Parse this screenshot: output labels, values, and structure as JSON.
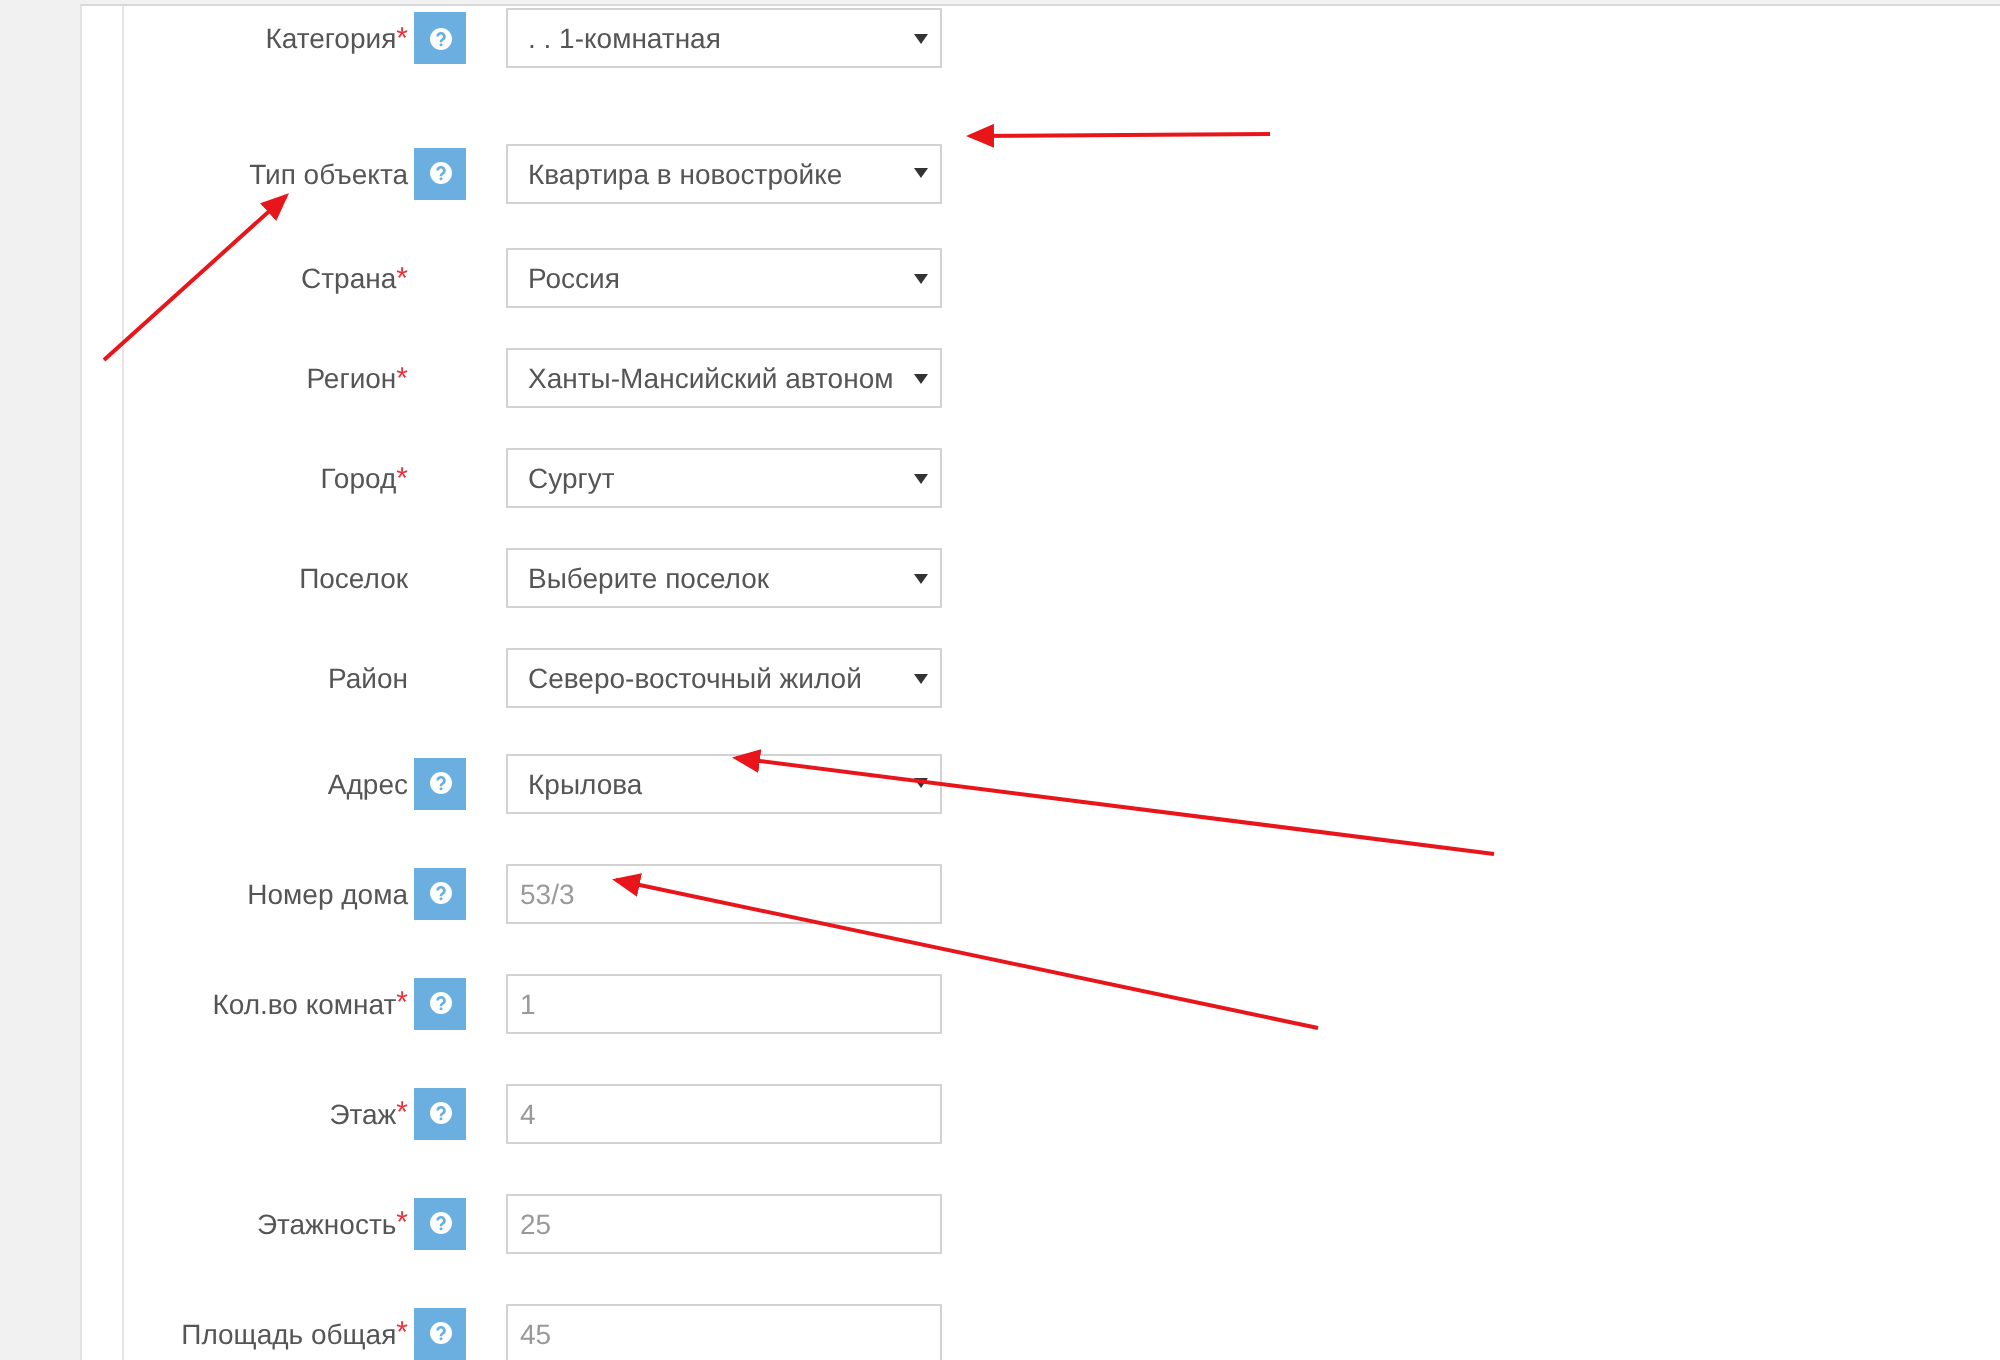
{
  "form": {
    "rows": [
      {
        "label": "Категория",
        "required_mark": "*",
        "help": true,
        "kind": "select",
        "value": ". . 1-комнатная"
      },
      {
        "label": "Тип объекта",
        "help": true,
        "kind": "select",
        "value": "Квартира в новостройке"
      },
      {
        "label": "Страна",
        "required_mark": "*",
        "help": false,
        "kind": "select",
        "value": "Россия"
      },
      {
        "label": "Регион",
        "required_mark": "*",
        "help": false,
        "kind": "select",
        "value": "Ханты-Мансийский автоном"
      },
      {
        "label": "Город",
        "required_mark": "*",
        "help": false,
        "kind": "select",
        "value": "Сургут"
      },
      {
        "label": "Поселок",
        "help": false,
        "kind": "select",
        "value": "Выберите поселок"
      },
      {
        "label": "Район",
        "help": false,
        "kind": "select",
        "value": "Северо-восточный жилой"
      },
      {
        "label": "Адрес",
        "help": true,
        "kind": "select",
        "value": "Крылова"
      },
      {
        "label": "Номер дома",
        "help": true,
        "kind": "input",
        "value": "53/3"
      },
      {
        "label": "Кол.во комнат",
        "required_mark": "*",
        "help": true,
        "kind": "input",
        "value": "1"
      },
      {
        "label": "Этаж",
        "required_mark": "*",
        "help": true,
        "kind": "input",
        "value": "4"
      },
      {
        "label": "Этажность",
        "required_mark": "*",
        "help": true,
        "kind": "input",
        "value": "25"
      },
      {
        "label": "Площадь общая",
        "required_mark": "*",
        "help": true,
        "kind": "input",
        "value": "45"
      }
    ]
  }
}
